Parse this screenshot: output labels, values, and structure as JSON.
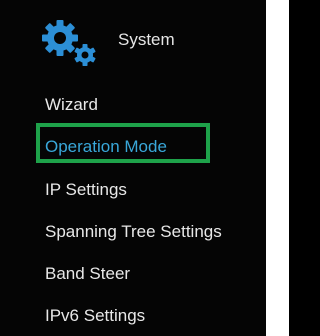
{
  "header": {
    "title": "System",
    "icon": "gears-icon"
  },
  "nav": {
    "items": [
      {
        "label": "Wizard",
        "active": false
      },
      {
        "label": "Operation Mode",
        "active": true
      },
      {
        "label": "IP Settings",
        "active": false
      },
      {
        "label": "Spanning Tree Settings",
        "active": false
      },
      {
        "label": "Band Steer",
        "active": false
      },
      {
        "label": "IPv6 Settings",
        "active": false
      }
    ]
  },
  "colors": {
    "background": "#050505",
    "text": "#e8e8e8",
    "active_text": "#39a7d9",
    "highlight_border": "#1ea24a",
    "gear_blue": "#2c8fd6"
  }
}
